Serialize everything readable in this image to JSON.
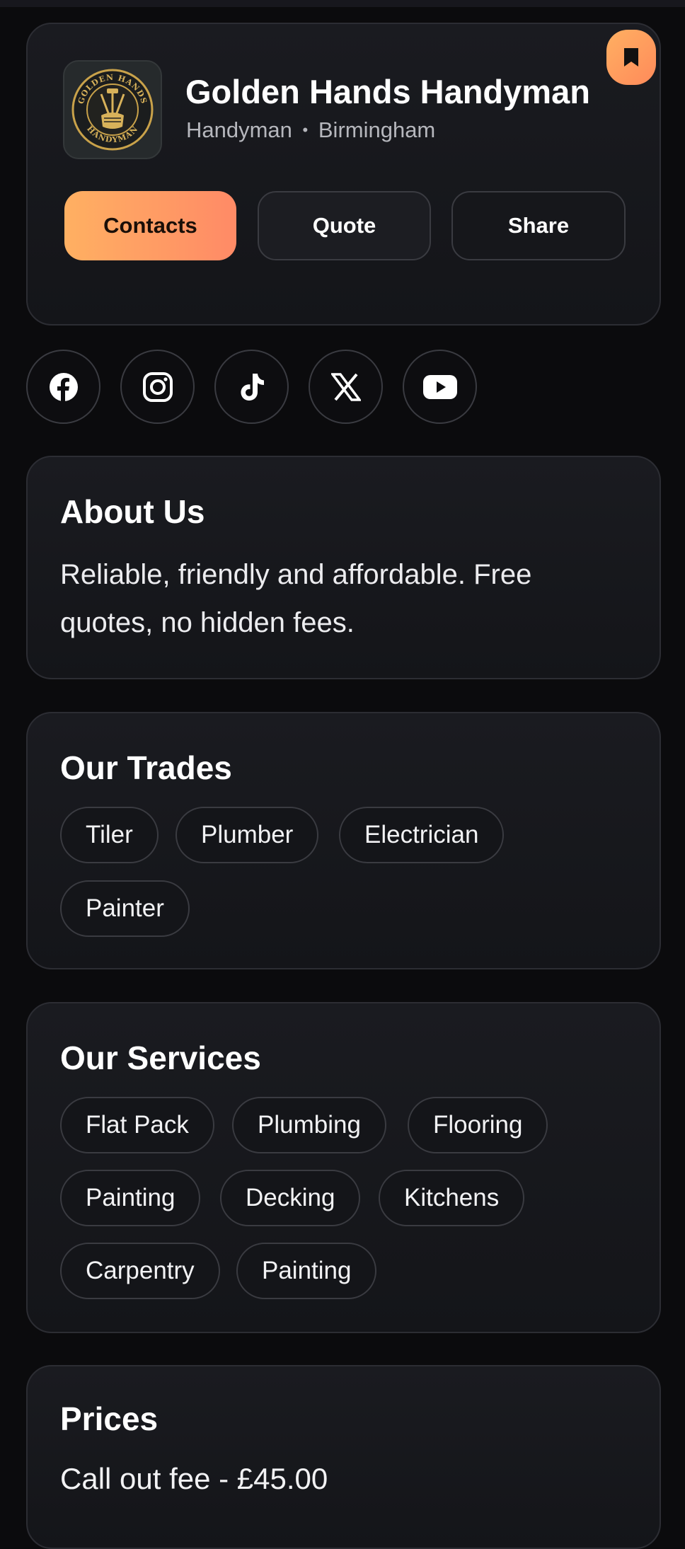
{
  "business": {
    "name": "Golden Hands Handyman",
    "category": "Handyman",
    "separator": "•",
    "location": "Birmingham",
    "logo_text_top": "GOLDEN HANDS",
    "logo_text_bottom": "HANDYMAN"
  },
  "actions": {
    "contacts_label": "Contacts",
    "quote_label": "Quote",
    "share_label": "Share"
  },
  "social": [
    "facebook-icon",
    "instagram-icon",
    "tiktok-icon",
    "x-icon",
    "youtube-icon"
  ],
  "about": {
    "title": "About Us",
    "text": "Reliable, friendly and affordable. Free quotes, no hidden fees."
  },
  "trades": {
    "title": "Our Trades",
    "items": [
      "Tiler",
      "Plumber",
      "Electrician",
      "Painter"
    ]
  },
  "services": {
    "title": "Our Services",
    "items": [
      "Flat Pack",
      "Plumbing",
      "Flooring",
      "Painting",
      "Decking",
      "Kitchens",
      "Carpentry",
      "Painting"
    ]
  },
  "prices": {
    "title": "Prices",
    "items": [
      "Call out fee - £45.00"
    ]
  },
  "colors": {
    "background": "#0b0b0d",
    "card": "#17181c",
    "accent_start": "#ffb062",
    "accent_end": "#ff8a66"
  }
}
